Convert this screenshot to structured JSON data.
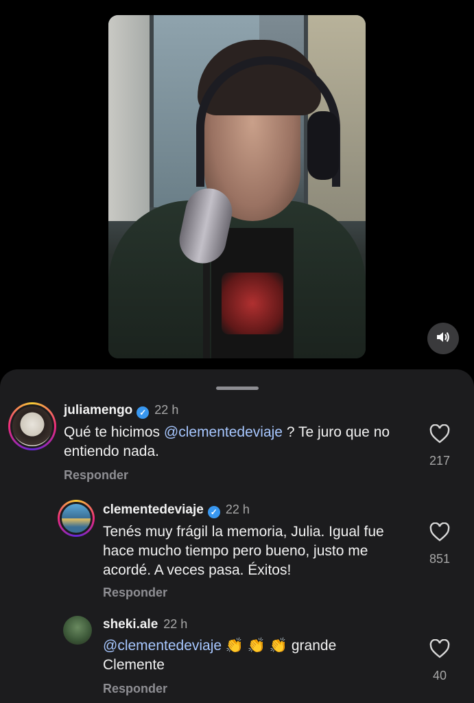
{
  "comments": [
    {
      "username": "juliamengo",
      "time": "22 h",
      "prefix": "",
      "mention": "",
      "text": "Qué te hicimos ",
      "mention_inline": "@clementedeviaje",
      "text_after": " ? Te juro que no entiendo nada.",
      "reply_label": "Responder",
      "likes": "217",
      "verified": true
    },
    {
      "username": "clementedeviaje",
      "time": "22 h",
      "text": "Tenés muy frágil la memoria, Julia. Igual fue hace mucho tiempo pero bueno, justo me acordé. A veces pasa. Éxitos!",
      "reply_label": "Responder",
      "likes": "851",
      "verified": true
    },
    {
      "username": "sheki.ale",
      "time": "22 h",
      "mention": "@clementedeviaje",
      "emojis": "👏 👏 👏",
      "text_after": " grande Clemente",
      "reply_label": "Responder",
      "likes": "40",
      "verified": false
    }
  ],
  "icons": {
    "verified": "verified-badge-icon",
    "like": "heart-outline-icon",
    "sound": "speaker-icon"
  },
  "colors": {
    "mention": "#a7c7ff",
    "verified": "#3897f0",
    "sheet_bg": "#1c1c1e"
  }
}
